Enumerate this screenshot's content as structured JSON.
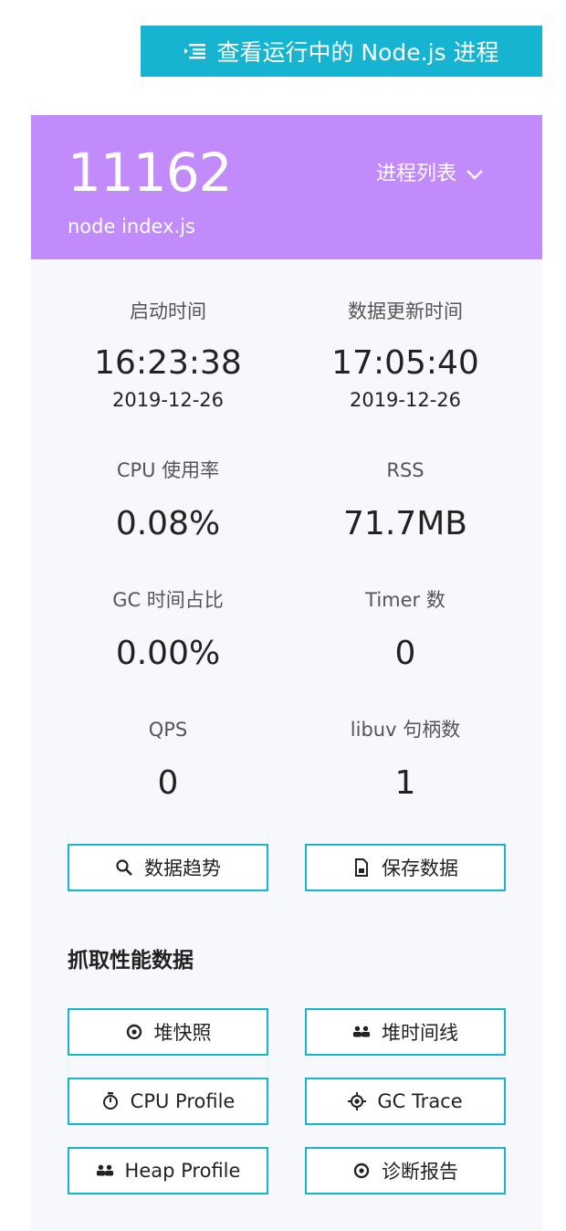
{
  "top_button": {
    "label": "查看运行中的 Node.js 进程",
    "color": "#17b4d2"
  },
  "process": {
    "pid": "11162",
    "command": "node index.js",
    "list_label": "进程列表",
    "header_color": "#c28bfc"
  },
  "metrics": {
    "start_time": {
      "label": "启动时间",
      "time": "16:23:38",
      "date": "2019-12-26"
    },
    "update_time": {
      "label": "数据更新时间",
      "time": "17:05:40",
      "date": "2019-12-26"
    },
    "cpu": {
      "label": "CPU 使用率",
      "value": "0.08%"
    },
    "rss": {
      "label": "RSS",
      "value": "71.7MB"
    },
    "gc": {
      "label": "GC 时间占比",
      "value": "0.00%"
    },
    "timer": {
      "label": "Timer 数",
      "value": "0"
    },
    "qps": {
      "label": "QPS",
      "value": "0"
    },
    "libuv": {
      "label": "libuv 句柄数",
      "value": "1"
    }
  },
  "actions": {
    "trend": "数据趋势",
    "save": "保存数据"
  },
  "capture": {
    "title": "抓取性能数据",
    "heap_snapshot": "堆快照",
    "heap_timeline": "堆时间线",
    "cpu_profile": "CPU Profile",
    "gc_trace": "GC Trace",
    "heap_profile": "Heap Profile",
    "diag_report": "诊断报告"
  }
}
